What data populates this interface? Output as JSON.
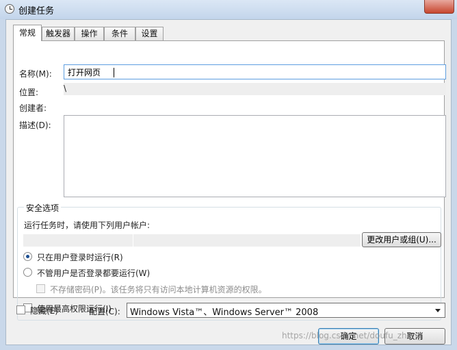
{
  "window": {
    "title": "创建任务",
    "icon": "clock-icon"
  },
  "tabs": [
    {
      "label": "常规",
      "active": true
    },
    {
      "label": "触发器",
      "active": false
    },
    {
      "label": "操作",
      "active": false
    },
    {
      "label": "条件",
      "active": false
    },
    {
      "label": "设置",
      "active": false
    }
  ],
  "general": {
    "name_label": "名称(M):",
    "name_value": "打开网页",
    "location_label": "位置:",
    "location_value": "\\",
    "author_label": "创建者:",
    "description_label": "描述(D):"
  },
  "security": {
    "title": "安全选项",
    "run_as_label": "运行任务时，请使用下列用户帐户:",
    "change_user_button": "更改用户或组(U)...",
    "radio_logged_on": "只在用户登录时运行(R)",
    "radio_logged_on_checked": true,
    "radio_whether_logged": "不管用户是否登录都要运行(W)",
    "radio_whether_logged_checked": false,
    "no_store_password": "不存储密码(P)。该任务将只有访问本地计算机资源的权限。",
    "highest_privileges": "使用最高权限运行(I)"
  },
  "footer": {
    "hidden_label": "隐藏(E)",
    "configure_label": "配置(C):",
    "configure_value": "Windows Vista™、Windows Server™ 2008",
    "ok_button": "确定",
    "cancel_button": "取消"
  },
  "watermark": "https://blog.csdn.net/doufu_zheng",
  "colors": {
    "focus_border": "#5d9ee0",
    "radio_dot": "#1c4e91",
    "close_button": "#c7462e"
  }
}
